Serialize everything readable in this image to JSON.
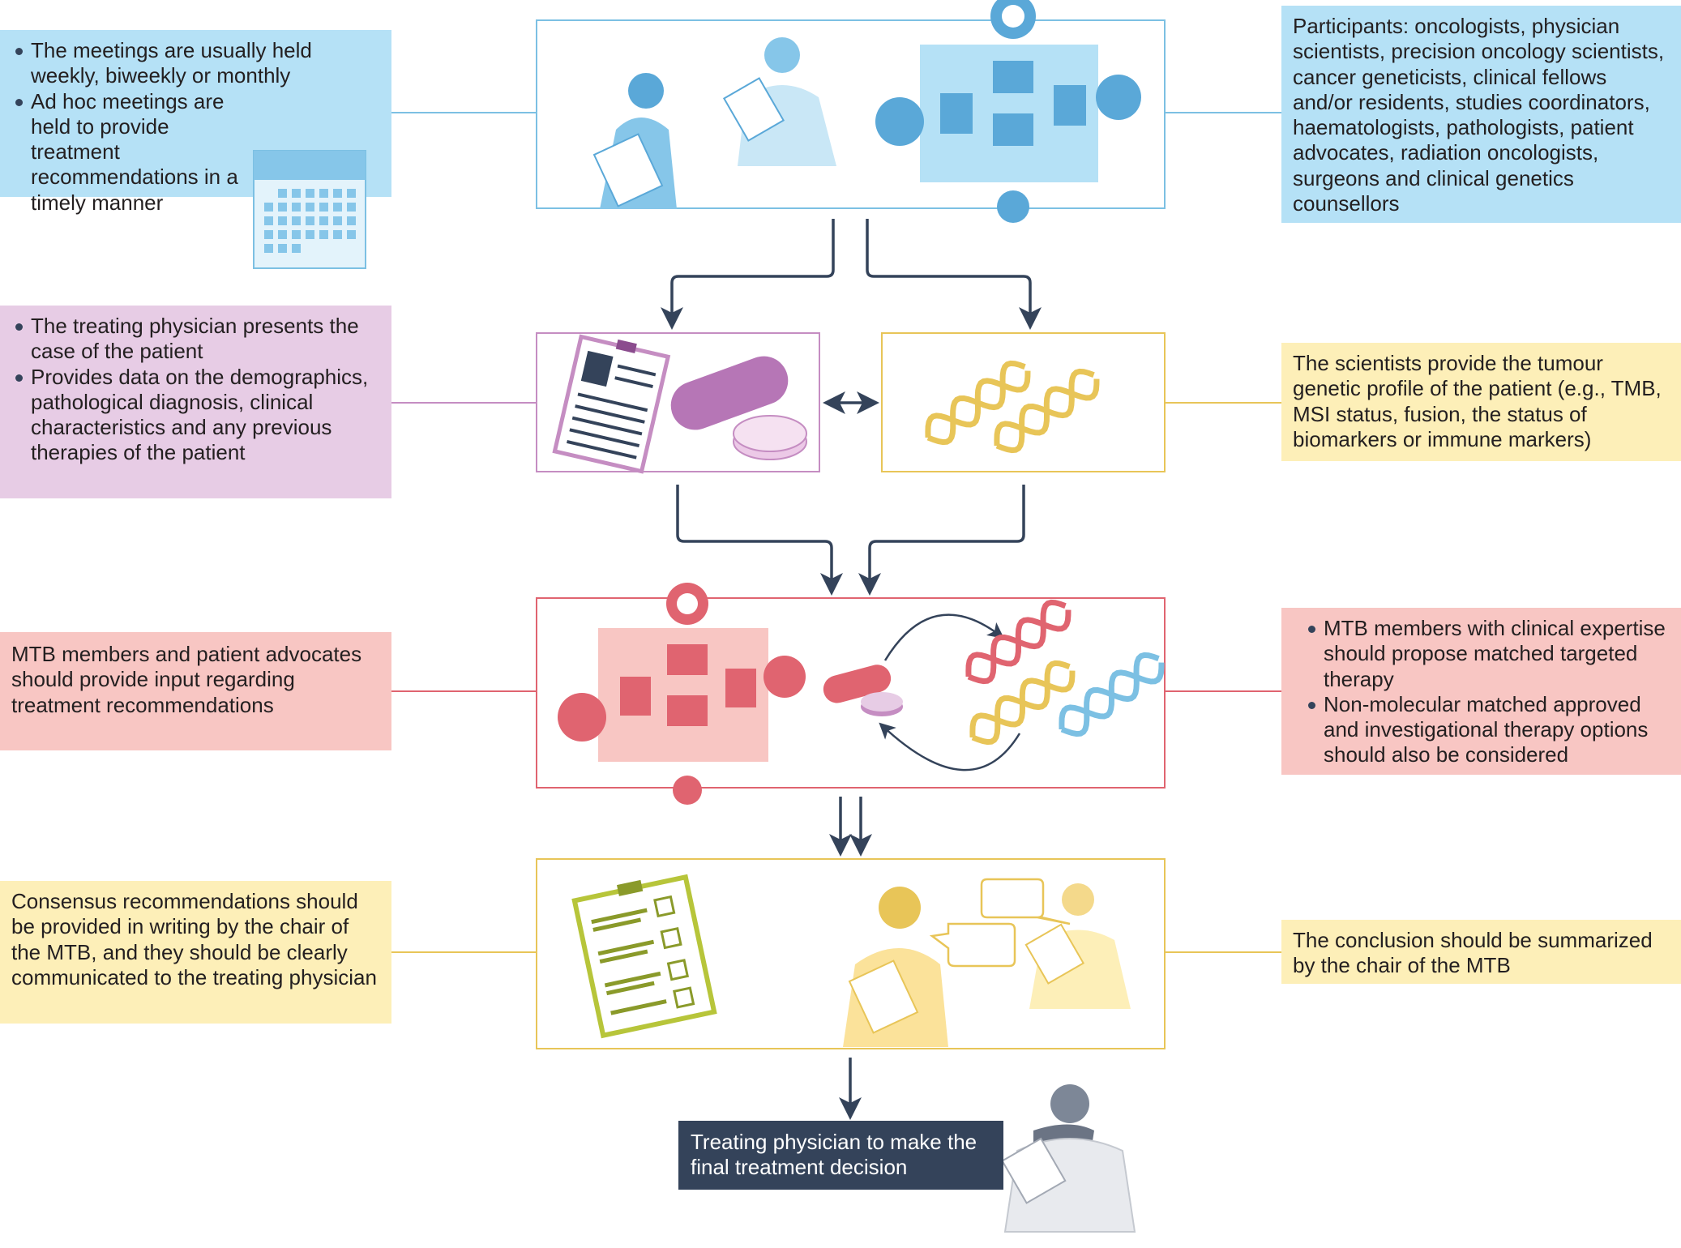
{
  "left_notes": {
    "meetings": [
      "The meetings are usually held weekly, biweekly or monthly",
      "Ad hoc meetings are held to provide treatment recommendations in a timely manner"
    ],
    "physician": [
      "The treating physician presents the case of the patient",
      "Provides data on the demographics, pathological diagnosis, clinical characteristics and any previous therapies of the patient"
    ],
    "input": "MTB members and patient advocates should provide input regarding treatment recommendations",
    "consensus": "Consensus recommendations should be provided in writing by the chair of the MTB, and they should be clearly communicated to the treating physician"
  },
  "right_notes": {
    "participants": "Participants: oncologists, physician scientists, precision oncology scientists, cancer geneticists, clinical fellows and/or residents, studies coordinators, haematologists, pathologists, patient advocates, radiation oncologists, surgeons and clinical genetics counsellors",
    "scientists": "The scientists provide the tumour genetic profile of the patient (e.g., TMB, MSI status, fusion, the status of biomarkers or immune markers)",
    "therapy": [
      "MTB members with clinical expertise should propose matched targeted therapy",
      "Non-molecular matched approved and investigational therapy options should also be considered"
    ],
    "conclusion": "The conclusion should be summarized by the chair of the MTB"
  },
  "final_decision": "Treating physician to make the final treatment decision",
  "colors": {
    "blue": "#b5e1f6",
    "blue_line": "#7cc0e3",
    "purple": "#e7cce5",
    "purple_line": "#c58dc2",
    "pink": "#f8c6c3",
    "red_line": "#e06470",
    "yellow": "#fdefb8",
    "yellow_line": "#e8c558",
    "arrow": "#34435a"
  },
  "icons": [
    "calendar-icon",
    "doctors-icon",
    "meeting-table-icon",
    "clipboard-icon",
    "pill-icon",
    "dna-icon",
    "speech-bubble-icon",
    "physician-icon"
  ]
}
